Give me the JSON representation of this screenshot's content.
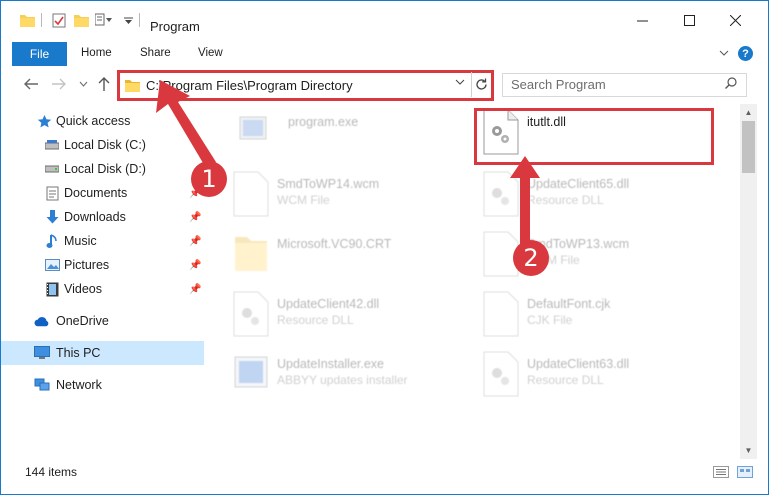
{
  "window": {
    "title": "Program"
  },
  "ribbon": {
    "tabs": [
      "File",
      "Home",
      "Share",
      "View"
    ],
    "help": "?"
  },
  "address_bar": {
    "path": "C:\\Program Files\\Program Directory"
  },
  "search": {
    "placeholder": "Search Program"
  },
  "nav_pane": {
    "items": [
      {
        "label": "Quick access",
        "icon": "star-icon"
      },
      {
        "label": "Local Disk (C:)",
        "icon": "drive-icon"
      },
      {
        "label": "Local Disk (D:)",
        "icon": "drive-icon"
      },
      {
        "label": "Documents",
        "icon": "documents-icon",
        "pinned": true
      },
      {
        "label": "Downloads",
        "icon": "download-icon",
        "pinned": true
      },
      {
        "label": "Music",
        "icon": "music-icon",
        "pinned": true
      },
      {
        "label": "Pictures",
        "icon": "pictures-icon",
        "pinned": true
      },
      {
        "label": "Videos",
        "icon": "videos-icon",
        "pinned": true
      },
      {
        "label": "OneDrive",
        "icon": "cloud-icon"
      },
      {
        "label": "This PC",
        "icon": "computer-icon",
        "selected": true
      },
      {
        "label": "Network",
        "icon": "network-icon"
      }
    ]
  },
  "files": [
    {
      "name": "program.exe",
      "type": "",
      "icon": "exe-icon",
      "faded": true
    },
    {
      "name": "itutlt.dll",
      "type": "",
      "icon": "dll-gear-icon",
      "faded": false
    },
    {
      "name": "SmdToWP14.wcm",
      "type": "WCM File",
      "icon": "file-icon",
      "faded": true
    },
    {
      "name": "UpdateClient65.dll",
      "type": "Resource DLL",
      "icon": "dll-gear-icon",
      "faded": true
    },
    {
      "name": "Microsoft.VC90.CRT",
      "type": "",
      "icon": "folder-icon",
      "faded": true
    },
    {
      "name": "SmdToWP13.wcm",
      "type": "WCM File",
      "icon": "file-icon",
      "faded": true
    },
    {
      "name": "UpdateClient42.dll",
      "type": "Resource DLL",
      "icon": "dll-gear-icon",
      "faded": true
    },
    {
      "name": "DefaultFont.cjk",
      "type": "CJK File",
      "icon": "file-icon",
      "faded": true
    },
    {
      "name": "UpdateInstaller.exe",
      "type": "ABBYY updates installer",
      "icon": "installer-icon",
      "faded": true
    },
    {
      "name": "UpdateClient63.dll",
      "type": "Resource DLL",
      "icon": "dll-gear-icon",
      "faded": true
    }
  ],
  "status": {
    "items_count": "144 items"
  },
  "annotations": {
    "badge1": "1",
    "badge2": "2"
  },
  "colors": {
    "accent": "#1979ca",
    "annotation_red": "#d9393e",
    "selection": "#cce8ff"
  }
}
